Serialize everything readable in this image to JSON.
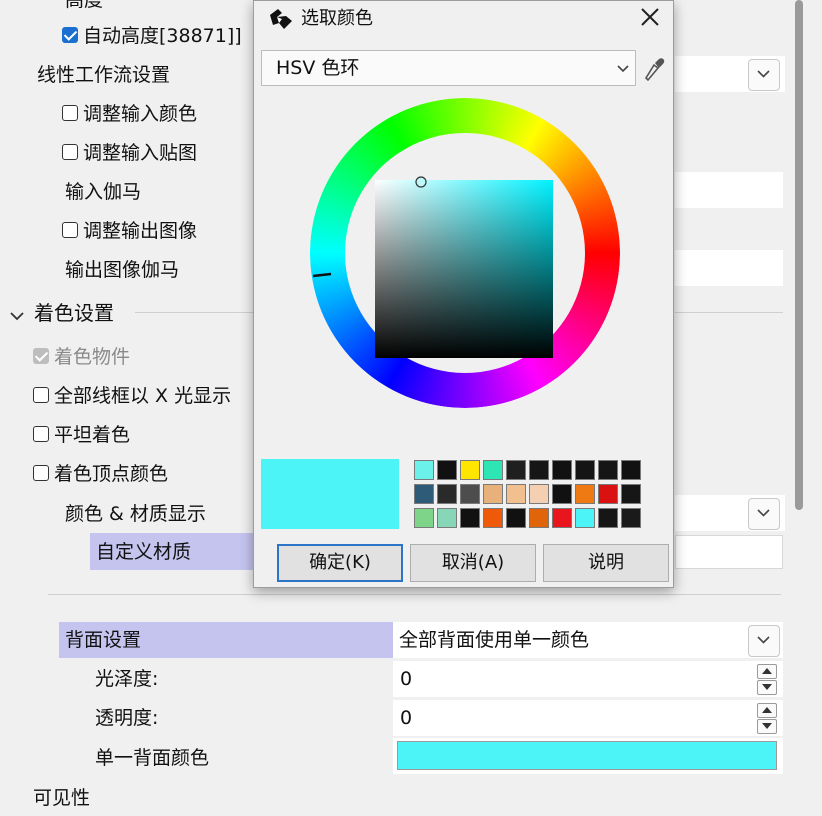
{
  "panel": {
    "top_cut_label": "高度",
    "auto_height_label": "自动高度[38871]]",
    "linear_workflow_label": "线性工作流设置",
    "adjust_input_color_label": "调整输入颜色",
    "adjust_input_texture_label": "调整输入贴图",
    "input_gamma_label": "输入伽马",
    "adjust_output_image_label": "调整输出图像",
    "output_gamma_label": "输出图像伽马",
    "shading_section_label": "着色设置",
    "shade_objects_label": "着色物件",
    "xray_wireframe_label": "全部线框以 X 光显示",
    "flat_shading_label": "平坦着色",
    "vertex_color_label": "着色顶点颜色",
    "color_material_display_label": "颜色 & 材质显示",
    "custom_material_label": "自定义材质",
    "backface_label": "背面设置",
    "backface_value": "全部背面使用单一颜色",
    "gloss_label": "光泽度:",
    "gloss_value": "0",
    "transparency_label": "透明度:",
    "transparency_value": "0",
    "single_back_color_label": "单一背面颜色",
    "bottom_cut_label": "可见性",
    "single_back_color": "#4df4f7"
  },
  "dialog": {
    "title": "选取颜色",
    "mode_select_value": "HSV 色环",
    "current_color": "#4df4f7",
    "ok_label": "确定(K)",
    "cancel_label": "取消(A)",
    "help_label": "说明",
    "swatches": [
      [
        "#6cf0ea",
        "#111111",
        "#ffe500",
        "#2ee6b4",
        "#1f1f1f",
        "#161616",
        "#111111",
        "#141414",
        "#161616",
        "#111111"
      ],
      [
        "#2e5c78",
        "#2a2a2a",
        "#4d4d4d",
        "#e8b07a",
        "#f2c08e",
        "#f5cfb2",
        "#111111",
        "#ef7a14",
        "#d91111",
        "#161616"
      ],
      [
        "#7ed488",
        "#88d6b8",
        "#111111",
        "#ee5a0a",
        "#111111",
        "#e0650a",
        "#e8161c",
        "#4df4f7",
        "#161616",
        "#1a1a1a"
      ]
    ]
  }
}
